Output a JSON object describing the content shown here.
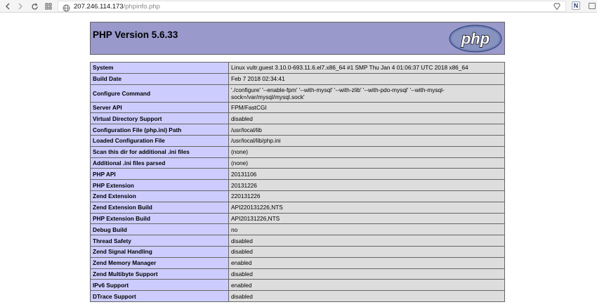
{
  "browser": {
    "url_host": "207.246.114.173",
    "url_path": "/phpinfo.php",
    "extension_label": "N"
  },
  "page": {
    "title": "PHP Version 5.6.33",
    "logo_text": "php"
  },
  "rows": [
    {
      "key": "System",
      "value": "Linux vultr.guest 3.10.0-693.11.6.el7.x86_64 #1 SMP Thu Jan 4 01:06:37 UTC 2018 x86_64"
    },
    {
      "key": "Build Date",
      "value": "Feb 7 2018 02:34:41"
    },
    {
      "key": "Configure Command",
      "value": "'./configure' '--enable-fpm' '--with-mysql' '--with-zlib' '--with-pdo-mysql' '--with-mysql-sock=/var/mysql/mysql.sock'"
    },
    {
      "key": "Server API",
      "value": "FPM/FastCGI"
    },
    {
      "key": "Virtual Directory Support",
      "value": "disabled"
    },
    {
      "key": "Configuration File (php.ini) Path",
      "value": "/usr/local/lib"
    },
    {
      "key": "Loaded Configuration File",
      "value": "/usr/local/lib/php.ini"
    },
    {
      "key": "Scan this dir for additional .ini files",
      "value": "(none)"
    },
    {
      "key": "Additional .ini files parsed",
      "value": "(none)"
    },
    {
      "key": "PHP API",
      "value": "20131106"
    },
    {
      "key": "PHP Extension",
      "value": "20131226"
    },
    {
      "key": "Zend Extension",
      "value": "220131226"
    },
    {
      "key": "Zend Extension Build",
      "value": "API220131226,NTS"
    },
    {
      "key": "PHP Extension Build",
      "value": "API20131226,NTS"
    },
    {
      "key": "Debug Build",
      "value": "no"
    },
    {
      "key": "Thread Safety",
      "value": "disabled"
    },
    {
      "key": "Zend Signal Handling",
      "value": "disabled"
    },
    {
      "key": "Zend Memory Manager",
      "value": "enabled"
    },
    {
      "key": "Zend Multibyte Support",
      "value": "disabled"
    },
    {
      "key": "IPv6 Support",
      "value": "enabled"
    },
    {
      "key": "DTrace Support",
      "value": "disabled"
    }
  ],
  "colors": {
    "header_bg": "#9999cc",
    "key_bg": "#ccccff",
    "value_bg": "#dddddd",
    "border": "#666666"
  }
}
